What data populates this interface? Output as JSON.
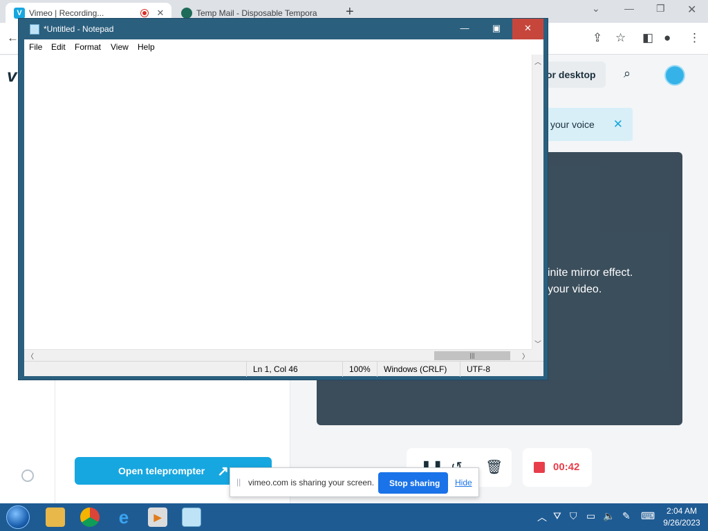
{
  "browser": {
    "tabs": [
      {
        "title": "Vimeo | Recording...",
        "favicon": "V"
      },
      {
        "title": "Temp Mail - Disposable Tempora"
      }
    ],
    "new_tab": "+"
  },
  "vimeo": {
    "download_label": "or desktop",
    "banner_text": "your voice",
    "preview_line1": "inite mirror effect.",
    "preview_line2": "your video.",
    "teleprompter_label": "Open teleprompter",
    "timer": "00:42",
    "accent_color": "#17a7e0",
    "record_color": "#e83e4b"
  },
  "sharebar": {
    "message": "vimeo.com is sharing your screen.",
    "stop_label": "Stop sharing",
    "hide_label": "Hide"
  },
  "notepad": {
    "title": "*Untitled - Notepad",
    "menu": [
      "File",
      "Edit",
      "Format",
      "View",
      "Help"
    ],
    "content": "",
    "status": {
      "position": "Ln 1, Col 46",
      "zoom": "100%",
      "line_ending": "Windows (CRLF)",
      "encoding": "UTF-8"
    }
  },
  "taskbar": {
    "time": "2:04 AM",
    "date": "9/26/2023"
  }
}
